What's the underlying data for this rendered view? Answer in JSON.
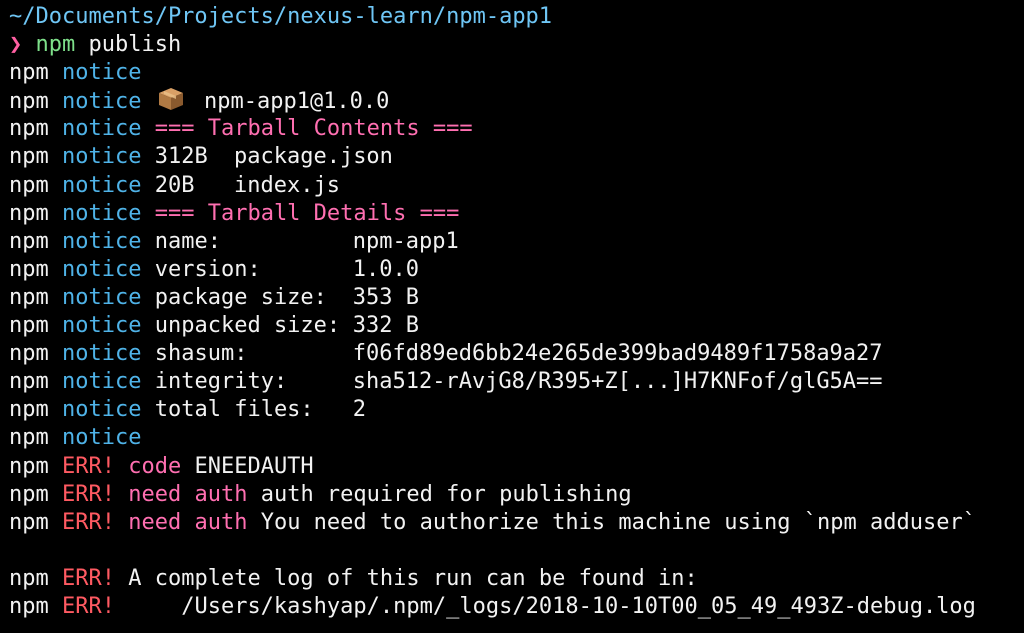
{
  "prompt": {
    "path": "~/Documents/Projects/nexus-learn/npm-app1",
    "symbol": "❯",
    "command": "npm",
    "argument": "publish"
  },
  "tokens": {
    "npm": "npm",
    "notice": "notice",
    "err": "ERR!"
  },
  "package_line": {
    "icon": "package-icon",
    "name": "npm-app1@1.0.0"
  },
  "tarball_contents": {
    "header": "=== Tarball Contents ===",
    "files": [
      {
        "size": "312B",
        "name": "package.json"
      },
      {
        "size": "20B",
        "name": "index.js"
      }
    ]
  },
  "tarball_details": {
    "header": "=== Tarball Details ===",
    "rows": [
      {
        "key": "name:",
        "value": "npm-app1"
      },
      {
        "key": "version:",
        "value": "1.0.0"
      },
      {
        "key": "package size:",
        "value": "353 B"
      },
      {
        "key": "unpacked size:",
        "value": "332 B"
      },
      {
        "key": "shasum:",
        "value": "f06fd89ed6bb24e265de399bad9489f1758a9a27"
      },
      {
        "key": "integrity:",
        "value": "sha512-rAvjG8/R395+Z[...]H7KNFof/glG5A=="
      },
      {
        "key": "total files:",
        "value": "2"
      }
    ]
  },
  "errors": {
    "code_label": "code",
    "code_value": "ENEEDAUTH",
    "need_auth_label": "need auth",
    "message1": "auth required for publishing",
    "message2": "You need to authorize this machine using `npm adduser`",
    "log_intro": "A complete log of this run can be found in:",
    "log_path": "    /Users/kashyap/.npm/_logs/2018-10-10T00_05_49_493Z-debug.log"
  },
  "colors": {
    "background": "#000000",
    "path": "#6fc6f5",
    "prompt_symbol": "#ff5fa2",
    "command": "#7ee08a",
    "notice": "#4fb3e8",
    "section_header": "#ff6fb1",
    "error": "#ff5a62",
    "text": "#f2f2f2"
  }
}
